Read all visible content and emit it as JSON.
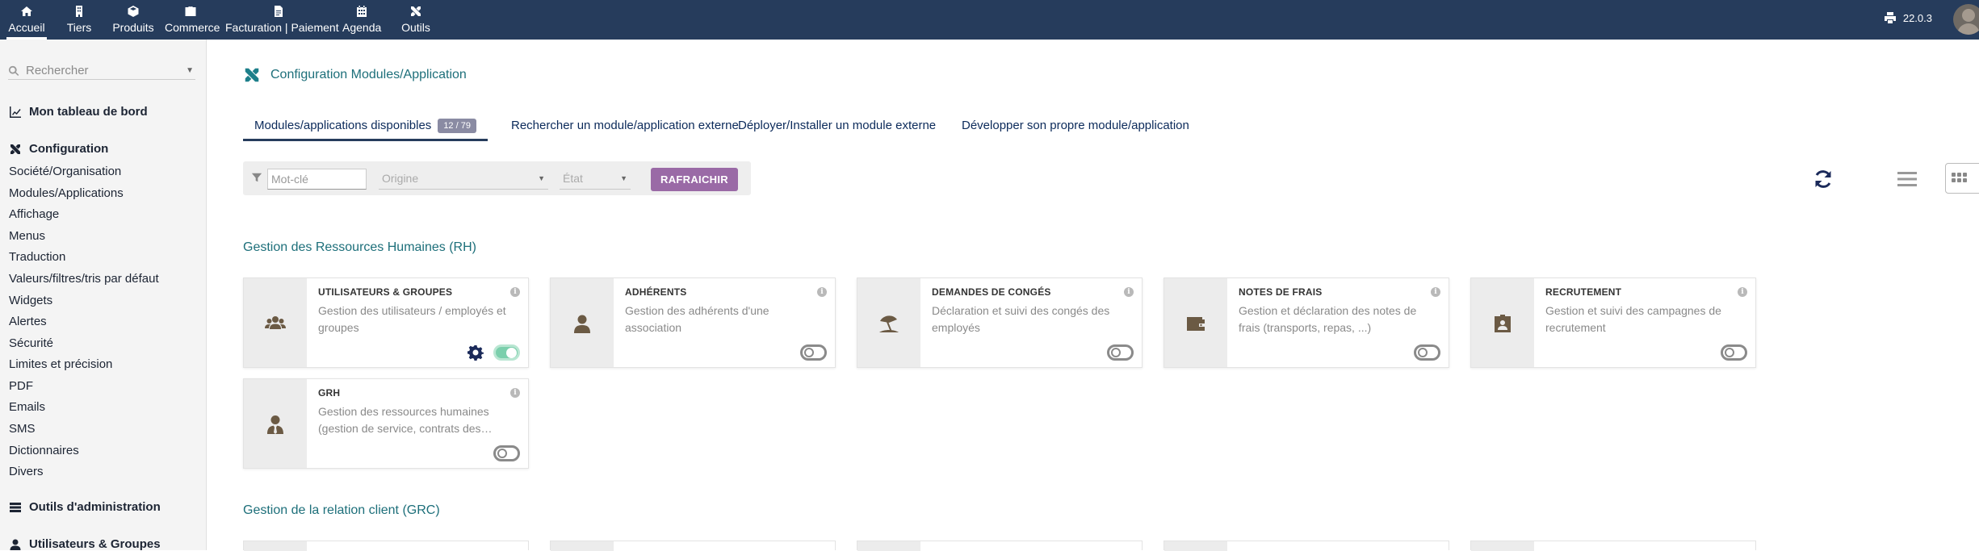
{
  "topnav": {
    "items": [
      {
        "label": "Accueil",
        "icon": "home-icon",
        "active": true
      },
      {
        "label": "Tiers",
        "icon": "building-icon"
      },
      {
        "label": "Produits",
        "icon": "cube-icon"
      },
      {
        "label": "Commerce",
        "icon": "briefcase-icon"
      },
      {
        "label": "Facturation | Paiement",
        "icon": "invoice-icon"
      },
      {
        "label": "Agenda",
        "icon": "calendar-icon"
      },
      {
        "label": "Outils",
        "icon": "tools-icon"
      }
    ],
    "version": "22.0.3"
  },
  "sidebar": {
    "search_placeholder": "Rechercher",
    "dashboard": "Mon tableau de bord",
    "config_title": "Configuration",
    "config_items": [
      "Société/Organisation",
      "Modules/Applications",
      "Affichage",
      "Menus",
      "Traduction",
      "Valeurs/filtres/tris par défaut",
      "Widgets",
      "Alertes",
      "Sécurité",
      "Limites et précision",
      "PDF",
      "Emails",
      "SMS",
      "Dictionnaires",
      "Divers"
    ],
    "admin_tools": "Outils d'administration",
    "users_groups": "Utilisateurs & Groupes"
  },
  "main": {
    "title": "Configuration Modules/Application",
    "tabs": [
      {
        "label": "Modules/applications disponibles",
        "badge": "12 / 79",
        "active": true
      },
      {
        "label": "Rechercher un module/application externe"
      },
      {
        "label": "Déployer/Installer un module externe"
      },
      {
        "label": "Développer son propre module/application"
      }
    ],
    "filters": {
      "keyword_placeholder": "Mot-clé",
      "origin_placeholder": "Origine",
      "state_placeholder": "État",
      "refresh_label": "RAFRAICHIR"
    },
    "sections": [
      {
        "title": "Gestion des Ressources Humaines (RH)",
        "cards": [
          {
            "title": "UTILISATEURS & GROUPES",
            "desc": "Gestion des utilisateurs / employés et groupes",
            "icon": "users-icon",
            "enabled": true
          },
          {
            "title": "ADHÉRENTS",
            "desc": "Gestion des adhérents d'une association",
            "icon": "user-icon",
            "enabled": false
          },
          {
            "title": "DEMANDES DE CONGÉS",
            "desc": "Déclaration et suivi des congés des employés",
            "icon": "umbrella-beach-icon",
            "enabled": false
          },
          {
            "title": "NOTES DE FRAIS",
            "desc": "Gestion et déclaration des notes de frais (transports, repas, ...)",
            "icon": "wallet-icon",
            "enabled": false
          },
          {
            "title": "RECRUTEMENT",
            "desc": "Gestion et suivi des campagnes de recrutement",
            "icon": "id-badge-icon",
            "enabled": false
          },
          {
            "title": "GRH",
            "desc": "Gestion des ressources humaines (gestion de service, contrats des…",
            "icon": "user-tie-icon",
            "enabled": false
          }
        ]
      },
      {
        "title": "Gestion de la relation client (GRC)",
        "cards": []
      }
    ]
  }
}
